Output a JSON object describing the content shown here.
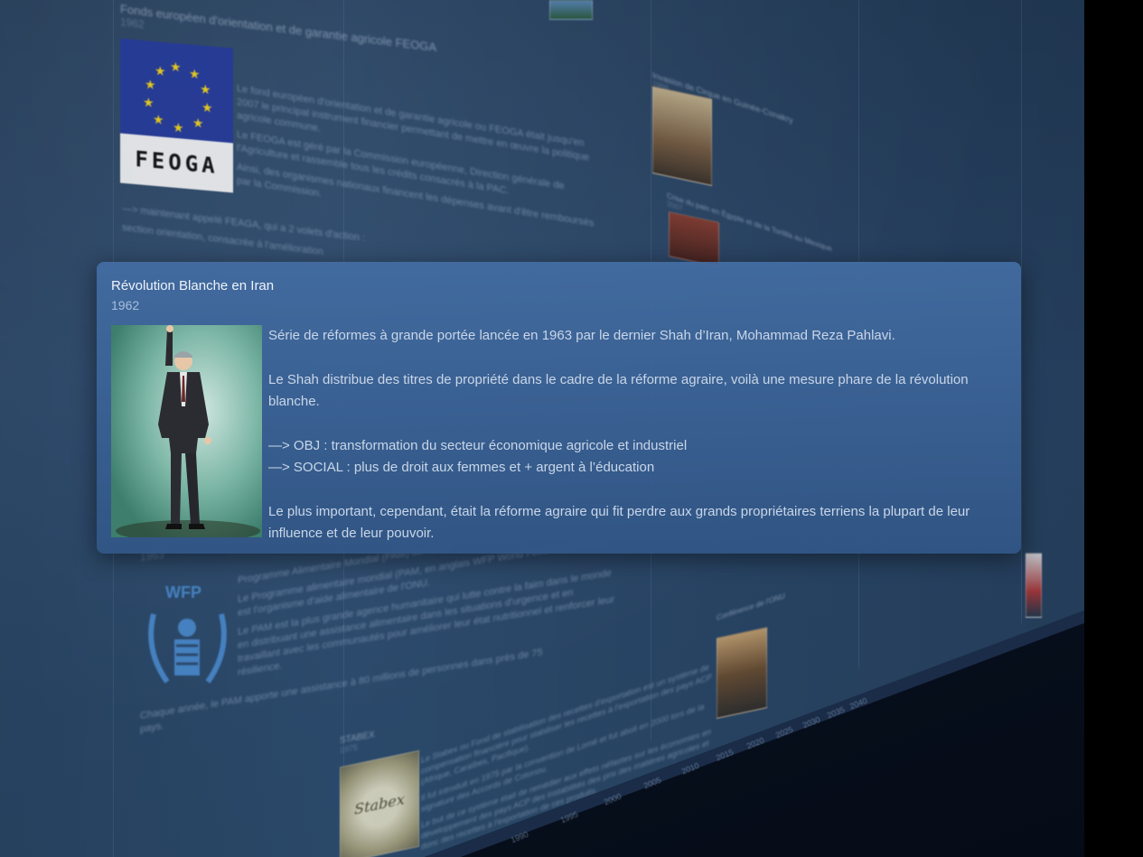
{
  "card": {
    "title": "Révolution Blanche en Iran",
    "year": "1962",
    "paragraphs": [
      "Série de réformes à grande portée lancée en 1963 par le dernier Shah d’Iran, Mohammad Reza Pahlavi.",
      "Le Shah distribue des titres de propriété dans le cadre de la réforme agraire, voilà une mesure phare de la révolution blanche."
    ],
    "obj_line": "—> OBJ : transformation du secteur économique agricole et industriel",
    "social_line": "—> SOCIAL : plus de droit aux femmes et + argent à l’éducation",
    "closing": "Le plus important, cependant, était la réforme agraire qui fit perdre aux grands propriétaires terriens la plupart de leur influence et de leur pouvoir.",
    "image_icon": "portrait-photo-icon"
  },
  "background": {
    "feoga": {
      "title": "Fonds européen d'orientation et de garantie agricole FEOGA",
      "year": "1962",
      "logo_text": "FEOGA",
      "p1": "Le fond européen d'orientation et de garantie agricole ou FEOGA était jusqu'en 2007 le principal instrument financier permettant de mettre en œuvre la politique agricole commune.",
      "p2": "Le FEOGA est géré par la Commission européenne, Direction générale de l'Agriculture et rassemble tous les crédits consacrés à la PAC.",
      "p3": "Ainsi, des organismes nationaux financent les dépenses avant d'être remboursés par la Commission.",
      "p4": "—> maintenant appelé FEAGA, qui a 2 volets d'action :",
      "p5": "section orientation, consacrée à l'amélioration"
    },
    "wfp": {
      "year": "1963",
      "logo_text": "WFP",
      "title": "Programme Alimentaire Mondial (PAM) de l'ONU",
      "p1": "Le Programme alimentaire mondial (PAM, en anglais WFP World Food Programme) est l'organisme d'aide alimentaire de l'ONU.",
      "p2": "Le PAM est la plus grande agence humanitaire qui lutte contre la faim dans le monde en distribuant une assistance alimentaire dans les situations d'urgence et en travaillant avec les communautés pour améliorer leur état nutritionnel et renforcer leur résilience.",
      "p3": "Chaque année, le PAM apporte une assistance à 80 millions de personnes dans près de 75 pays."
    },
    "stabex": {
      "title": "STABEX",
      "year": "1975",
      "logo_text": "Stabex",
      "p1": "Le Stabex ou Fond de stabilisation des recettes d'exportation est un système de compensation financière pour stabiliser les recettes à l'exportation des pays ACP (Afrique, Caraïbes, Pacifique).",
      "p2": "Il fut introduit en 1975 par la convention de Lomé et fut aboli en 2000 lors de la signature des Accords de Cotonou.",
      "p3": "Le but de ce système était de remédier aux effets néfastes sur les économies en développement des pays ACP des instabilités des prix des matières agricoles et donc des recettes à l'exportation de ces produits."
    },
    "right_entries": [
      {
        "title": "Invasion de Cirque en Guinée-Conakry",
        "year": "1968"
      },
      {
        "title": "Crise du pain en Égypte et de la Tortilla au Mexique",
        "year": "2007"
      },
      {
        "title": "Conférence de l'ONU",
        "year": "1974"
      }
    ],
    "timeline_years": [
      "1990",
      "1995",
      "2000",
      "2005",
      "2010",
      "2015",
      "2020",
      "2025",
      "2030",
      "2035",
      "2040"
    ]
  },
  "colors": {
    "card_bg": "#436da3",
    "wall_bg": "#2c4a6e",
    "text_light": "#c9d6e8"
  }
}
